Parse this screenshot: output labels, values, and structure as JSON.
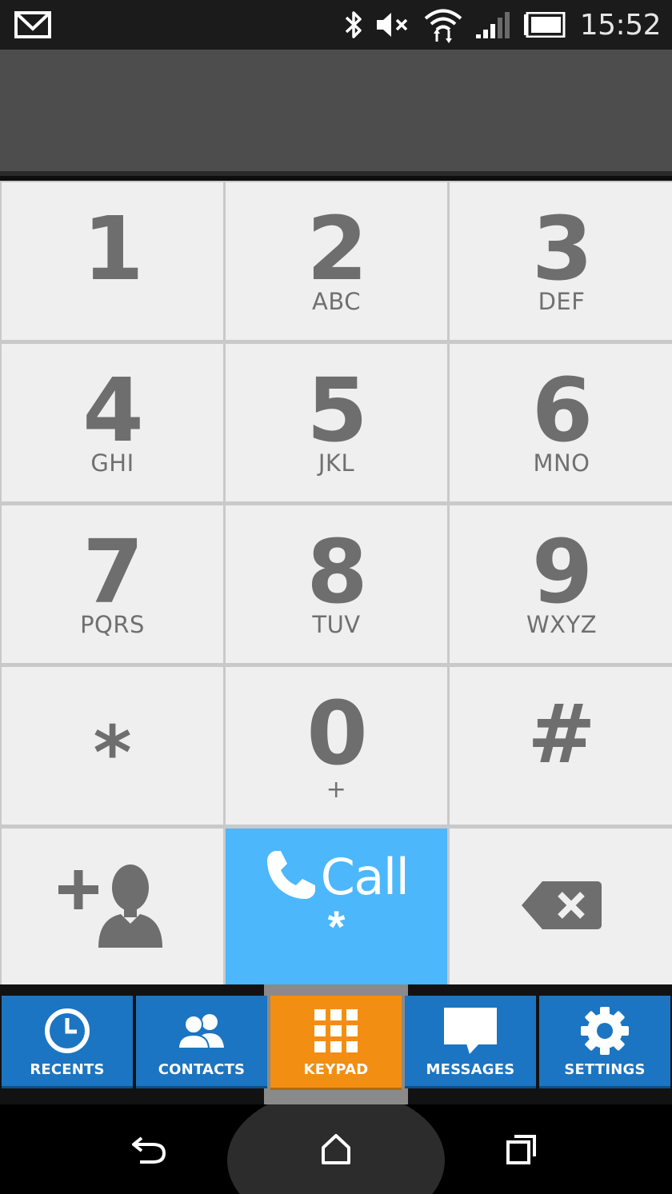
{
  "status_bar": {
    "time": "15:52",
    "icons": [
      "gmail-icon",
      "bluetooth-icon",
      "volume-muted-icon",
      "wifi-icon",
      "signal-icon",
      "battery-icon"
    ]
  },
  "display": {
    "number": ""
  },
  "keypad": {
    "keys": [
      {
        "digit": "1",
        "letters": ""
      },
      {
        "digit": "2",
        "letters": "ABC"
      },
      {
        "digit": "3",
        "letters": "DEF"
      },
      {
        "digit": "4",
        "letters": "GHI"
      },
      {
        "digit": "5",
        "letters": "JKL"
      },
      {
        "digit": "6",
        "letters": "MNO"
      },
      {
        "digit": "7",
        "letters": "PQRS"
      },
      {
        "digit": "8",
        "letters": "TUV"
      },
      {
        "digit": "9",
        "letters": "WXYZ"
      },
      {
        "digit": "*",
        "letters": ""
      },
      {
        "digit": "0",
        "letters": "+"
      },
      {
        "digit": "#",
        "letters": ""
      }
    ],
    "add_contact_icon": "add-contact-icon",
    "call": {
      "label": "Call",
      "sub_symbol": "*",
      "color": "#4cb7fb"
    },
    "backspace_icon": "backspace-icon"
  },
  "tabs": [
    {
      "label": "RECENTS",
      "icon": "clock-icon",
      "active": false
    },
    {
      "label": "CONTACTS",
      "icon": "people-icon",
      "active": false
    },
    {
      "label": "KEYPAD",
      "icon": "keypad-grid-icon",
      "active": true
    },
    {
      "label": "MESSAGES",
      "icon": "message-bubble-icon",
      "active": false
    },
    {
      "label": "SETTINGS",
      "icon": "gear-icon",
      "active": false
    }
  ],
  "colors": {
    "tab_default": "#1b75c2",
    "tab_active": "#f28e12",
    "key_background": "#efefef",
    "key_text": "#6e6e6e"
  },
  "nav_bar": {
    "icons": [
      "back-icon",
      "home-icon",
      "recent-apps-icon"
    ]
  }
}
